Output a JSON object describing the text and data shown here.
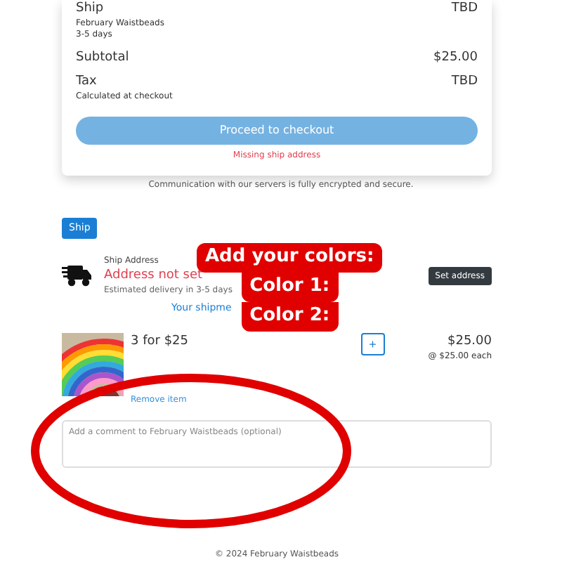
{
  "summary": {
    "ship": {
      "label": "Ship",
      "value": "TBD",
      "store": "February Waistbeads",
      "days": "3-5 days"
    },
    "subtotal": {
      "label": "Subtotal",
      "value": "$25.00"
    },
    "tax": {
      "label": "Tax",
      "value": "TBD",
      "note": "Calculated at checkout"
    },
    "checkout_button": {
      "label": "Proceed to checkout",
      "disabled": true
    },
    "error": "Missing ship address"
  },
  "security_note": "Communication with our servers is fully encrypted and secure.",
  "tabs": [
    {
      "label": "Ship",
      "selected": true
    }
  ],
  "shipping": {
    "heading": "Ship Address",
    "status": "Address not set",
    "estimate": "Estimated delivery in 3-5 days",
    "button": "Set address"
  },
  "shipment_title": "Your shipme",
  "item": {
    "kind": "picture",
    "name": "3 for $25",
    "price": "$25.00",
    "each": "@ $25.00 each",
    "remove": "Remove item",
    "plus": "+"
  },
  "comment": {
    "placeholder": "Add a comment to February Waistbeads (optional)"
  },
  "callout": [
    "Add your colors:",
    "Color 1:",
    "Color 2:"
  ],
  "footer": "© 2024 February Waistbeads"
}
